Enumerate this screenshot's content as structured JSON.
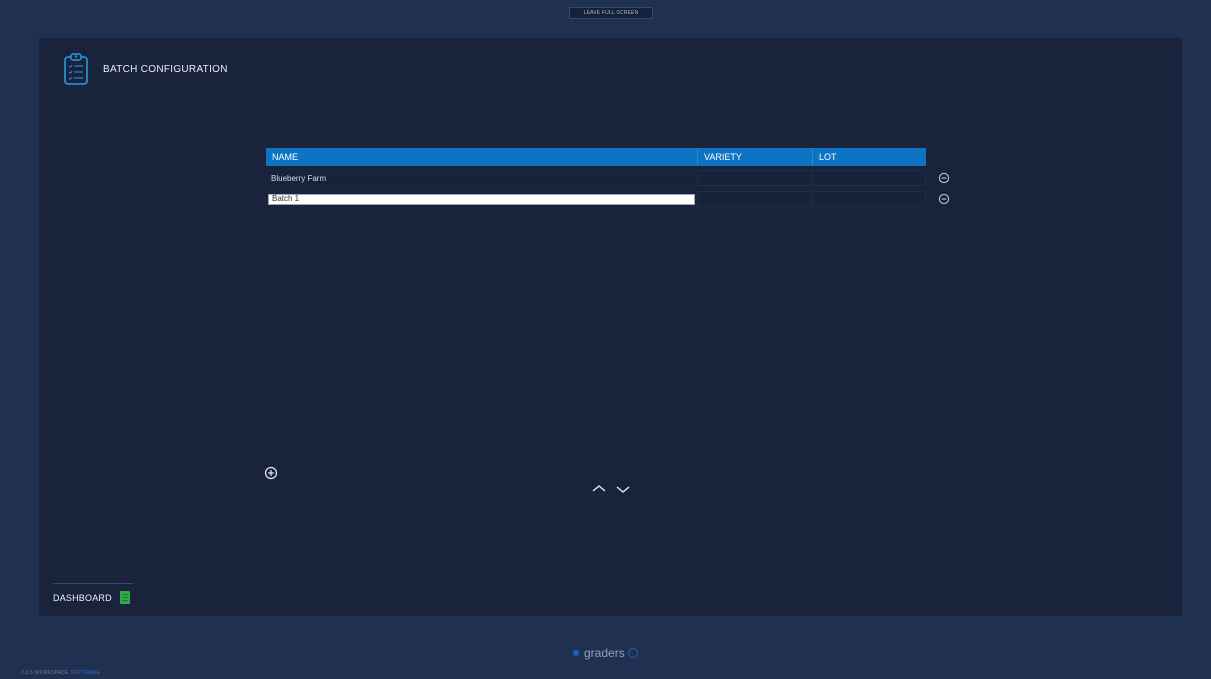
{
  "topbar": {
    "fullscreen_label": "LEAVE FULL SCREEN"
  },
  "header": {
    "title": "BATCH CONFIGURATION",
    "icon": "clipboard-icon"
  },
  "table": {
    "columns": [
      "NAME",
      "VARIETY",
      "LOT"
    ],
    "rows": [
      {
        "name": "Blueberry Farm",
        "variety": "",
        "lot": ""
      }
    ],
    "editing_row": {
      "name_value": "Batch 1",
      "variety": "",
      "lot": ""
    }
  },
  "controls": {
    "add_icon": "plus-circle-icon",
    "remove_icon": "minus-circle-icon",
    "scroll_up_icon": "chevron-up-icon",
    "scroll_down_icon": "chevron-down-icon"
  },
  "nav": {
    "dashboard_label": "DASHBOARD",
    "dashboard_icon": "dashboard-icon"
  },
  "footer": {
    "brand": "graders",
    "version": "2.2.6",
    "workspace": "WORKSPACE",
    "workspace_suffix": "SOFTWARE"
  },
  "colors": {
    "background": "#1f3050",
    "panel": "#19233c",
    "table_header": "#0c74c2",
    "dashboard_accent": "#2eaa48"
  }
}
